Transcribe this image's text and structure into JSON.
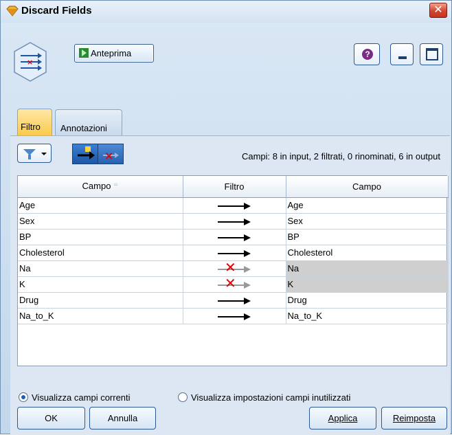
{
  "window": {
    "title": "Discard Fields"
  },
  "toolbar": {
    "preview_label": "Anteprima"
  },
  "tabs": [
    {
      "label": "Filtro"
    },
    {
      "label": "Annotazioni"
    }
  ],
  "summary": "Campi: 8 in input, 2 filtrati, 0 rinominati, 6 in output",
  "table": {
    "headers": [
      "Campo",
      "Filtro",
      "Campo"
    ],
    "rows": [
      {
        "in": "Age",
        "out": "Age",
        "filtered": false
      },
      {
        "in": "Sex",
        "out": "Sex",
        "filtered": false
      },
      {
        "in": "BP",
        "out": "BP",
        "filtered": false
      },
      {
        "in": "Cholesterol",
        "out": "Cholesterol",
        "filtered": false
      },
      {
        "in": "Na",
        "out": "Na",
        "filtered": true
      },
      {
        "in": "K",
        "out": "K",
        "filtered": true
      },
      {
        "in": "Drug",
        "out": "Drug",
        "filtered": false
      },
      {
        "in": "Na_to_K",
        "out": "Na_to_K",
        "filtered": false
      }
    ]
  },
  "options": {
    "current_fields": "Visualizza campi correnti",
    "unused_fields": "Visualizza impostazioni campi inutilizzati"
  },
  "buttons": {
    "ok": "OK",
    "cancel": "Annulla",
    "apply": "Applica",
    "reset": "Reimposta"
  },
  "colors": {
    "active_tab": "#f9c94a",
    "filtered_x": "#e00000",
    "filtered_row": "#cfcfcf"
  }
}
